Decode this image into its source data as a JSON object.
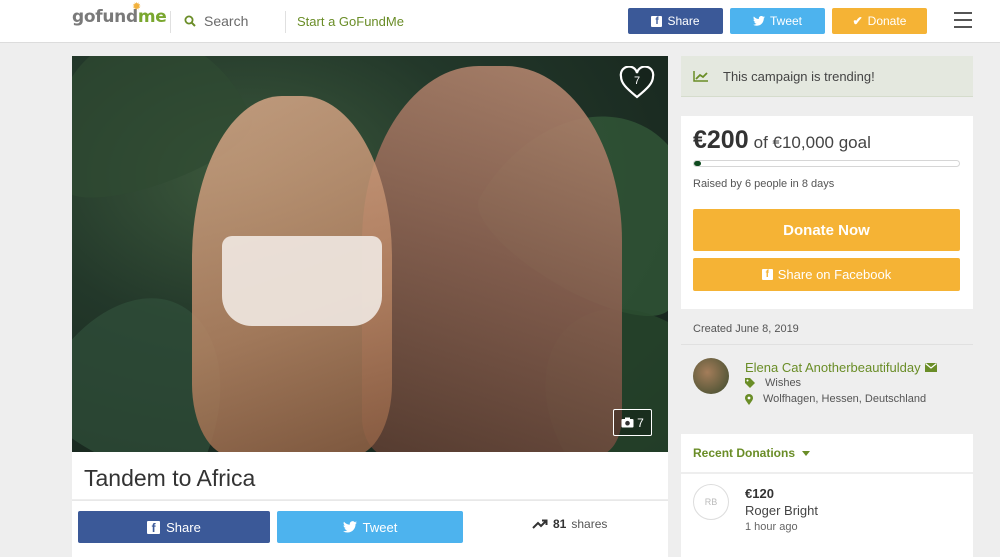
{
  "header": {
    "logo_go": "go",
    "logo_fund": "fund",
    "logo_me": "me",
    "search_label": "Search",
    "start_link": "Start a GoFundMe",
    "share_label": "Share",
    "tweet_label": "Tweet",
    "donate_label": "Donate"
  },
  "hero": {
    "heart_count": "7",
    "photo_count": "7"
  },
  "campaign": {
    "title": "Tandem to Africa",
    "share_label": "Share",
    "tweet_label": "Tweet",
    "shares_count": "81",
    "shares_label": "shares"
  },
  "sidebar": {
    "trending_text": "This campaign is trending!",
    "raised_amount": "€200",
    "goal_text": "of €10,000 goal",
    "progress_fraction": 0.02,
    "raised_by": "Raised by 6 people in 8 days",
    "donate_now": "Donate Now",
    "share_facebook": "Share on Facebook",
    "created": "Created June 8, 2019",
    "organizer_name": "Elena Cat Anotherbeautifulday",
    "organizer_category": "Wishes",
    "organizer_location": "Wolfhagen, Hessen, Deutschland",
    "recent_title": "Recent Donations",
    "donations": [
      {
        "initials": "RB",
        "amount": "€120",
        "name": "Roger Bright",
        "time": "1 hour ago"
      }
    ]
  },
  "colors": {
    "brand_green": "#6a8d27",
    "facebook": "#3b5998",
    "twitter": "#4db3ee",
    "donate": "#f5b335"
  }
}
